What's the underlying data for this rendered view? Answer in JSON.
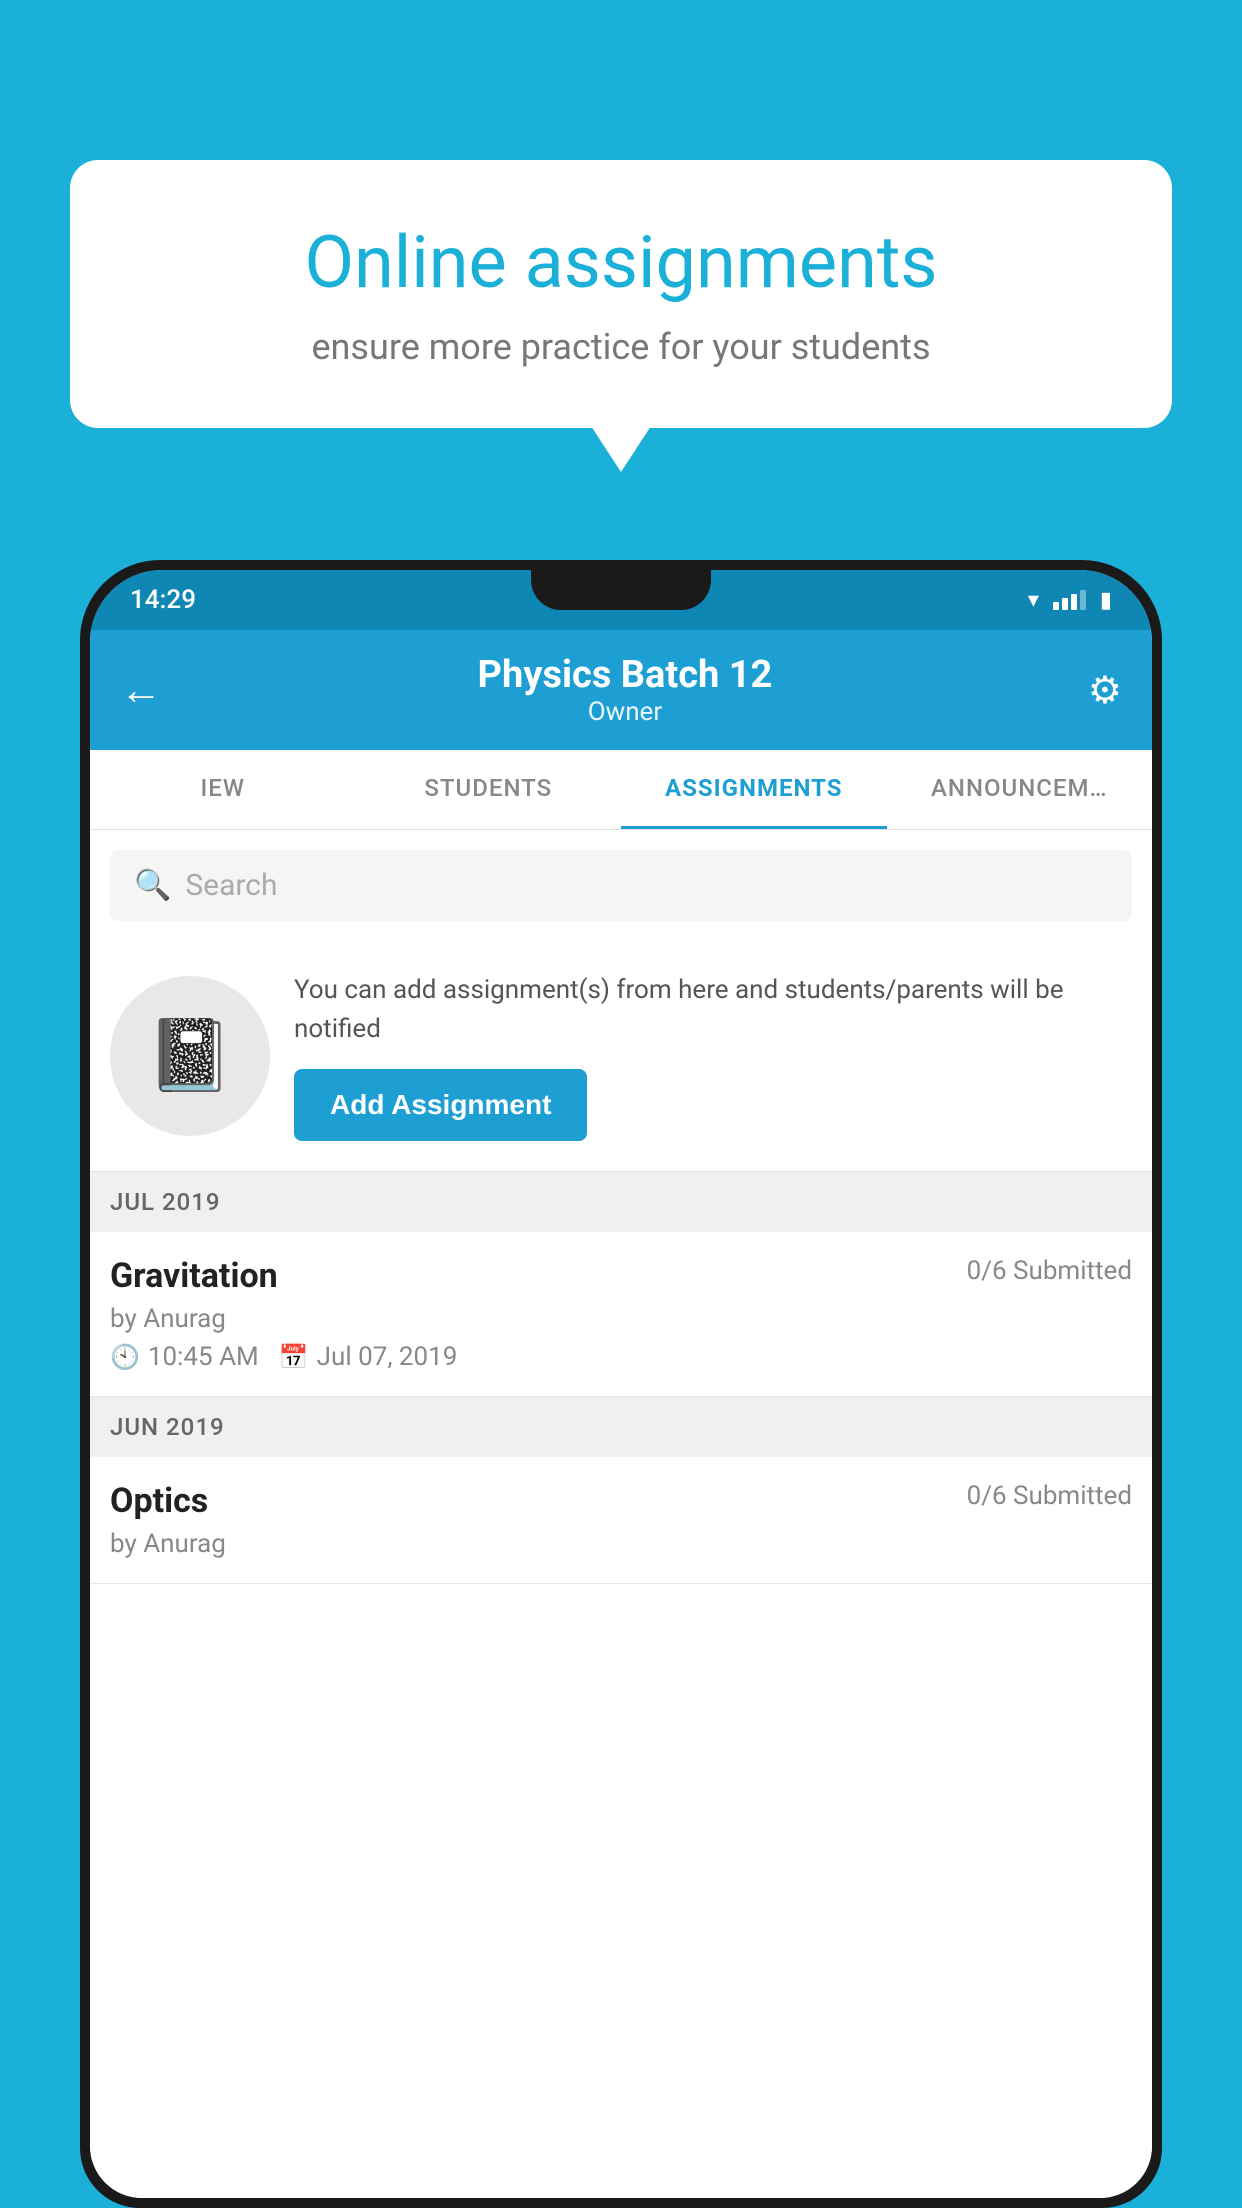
{
  "background_color": "#1ab0d8",
  "speech_bubble": {
    "title": "Online assignments",
    "subtitle": "ensure more practice for your students"
  },
  "status_bar": {
    "time": "14:29"
  },
  "app_header": {
    "title": "Physics Batch 12",
    "subtitle": "Owner"
  },
  "tabs": [
    {
      "label": "IEW",
      "active": false
    },
    {
      "label": "STUDENTS",
      "active": false
    },
    {
      "label": "ASSIGNMENTS",
      "active": true
    },
    {
      "label": "ANNOUNCEM…",
      "active": false
    }
  ],
  "search": {
    "placeholder": "Search"
  },
  "empty_state": {
    "description": "You can add assignment(s) from here and students/parents will be notified",
    "button_label": "Add Assignment"
  },
  "sections": [
    {
      "header": "JUL 2019",
      "assignments": [
        {
          "name": "Gravitation",
          "submitted": "0/6 Submitted",
          "by": "by Anurag",
          "time": "10:45 AM",
          "date": "Jul 07, 2019"
        }
      ]
    },
    {
      "header": "JUN 2019",
      "assignments": [
        {
          "name": "Optics",
          "submitted": "0/6 Submitted",
          "by": "by Anurag",
          "time": "",
          "date": ""
        }
      ]
    }
  ]
}
